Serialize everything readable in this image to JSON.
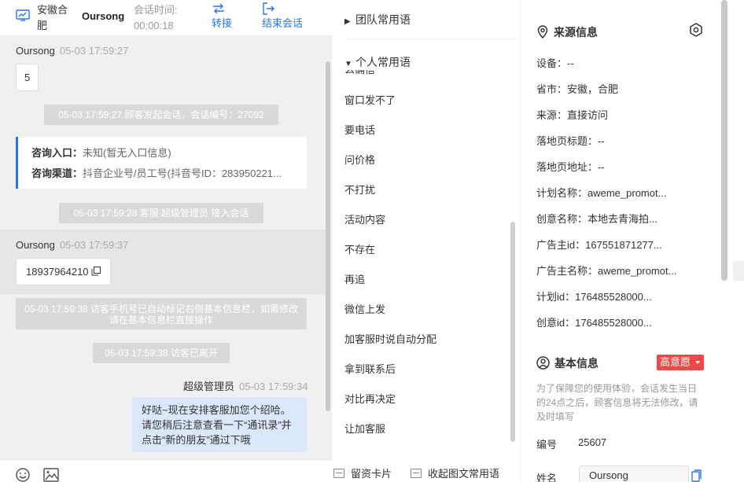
{
  "header": {
    "location": "安徽合肥",
    "visitor_name": "Oursong",
    "session_time_label": "会话时间:",
    "session_time_value": "00:00:18",
    "transfer_label": "转接",
    "end_label": "结束会话"
  },
  "messages": {
    "m1_sender": "Oursong",
    "m1_time": "05-03 17:59:27",
    "m1_text": "5",
    "sys1": "05-03 17:59:27 顾客发起会话，会话编号：27092",
    "card_entry_label": "咨询入口：",
    "card_entry_value": "未知(暂无入口信息)",
    "card_channel_label": "咨询渠道：",
    "card_channel_value": "抖音企业号/员工号(抖音号ID：283950221...",
    "sys2": "05-03 17:59:28 客服 超级管理员 接入会话",
    "m2_sender": "Oursong",
    "m2_time": "05-03 17:59:37",
    "m2_text": "18937964210",
    "sys3": "05-03 17:59:38 访客手机号已自动标记右侧基本信息栏，如需修改请在基本信息栏直接操作",
    "sys4": "05-03 17:59:38 访客已离开",
    "m3_sender": "超级管理员",
    "m3_time": "05-03 17:59:34",
    "m3_text": "好哒~现在安排客服加您个绍哈。请您稍后注意查看一下“通讯录”并点击“新的朋友”通过下哦"
  },
  "quick_replies": {
    "team_group": "团队常用语",
    "personal_group": "个人常用语",
    "partial_item": "么确信",
    "items": [
      "窗口发不了",
      "要电话",
      "问价格",
      "不打扰",
      "活动内容",
      "不存在",
      "再追",
      "微信上发",
      "加客服时说自动分配",
      "拿到联系后",
      "对比再决定",
      "让加客服"
    ],
    "footer_card": "留资卡片",
    "footer_collapse": "收起图文常用语"
  },
  "source_info": {
    "title": "来源信息",
    "device": "设备：--",
    "province": "省市：安徽，合肥",
    "source": "来源：直接访问",
    "landing_title": "落地页标题：--",
    "landing_url": "落地页地址：--",
    "plan_name": "计划名称：aweme_promot...",
    "creative_name": "创意名称：本地去青海拍...",
    "advertiser_id": "广告主id：167551871277...",
    "advertiser_name": "广告主名称：aweme_promot...",
    "plan_id": "计划id：176485528000...",
    "creative_id": "创意id：176485528000..."
  },
  "basic_info": {
    "title": "基本信息",
    "intent_tag": "高意愿",
    "notice": "为了保障您的使用体验，会话发生当日的24点之后，顾客信息将无法修改，请及时填写",
    "number_label": "编号",
    "number_value": "25607",
    "name_label": "姓名",
    "name_value": "Oursong"
  },
  "colors": {
    "accent": "#2c73e8",
    "system_msg_bg": "#d9d9d9",
    "agent_bubble_bg": "#dbe8fb",
    "tag_red": "#f04848"
  }
}
